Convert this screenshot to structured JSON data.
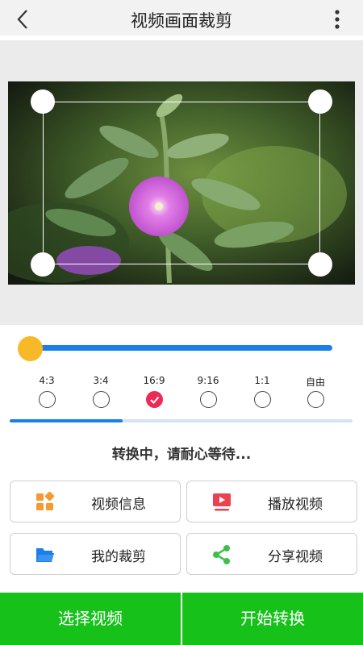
{
  "header": {
    "title": "视频画面裁剪",
    "back_icon": "back-arrow-icon",
    "more_icon": "more-vertical-icon"
  },
  "preview": {
    "image": "flower-photo",
    "handle_color": "#ffffff"
  },
  "slider": {
    "value_fraction": 0.0,
    "track_color": "#1a7fe8",
    "thumb_color": "#f7b928"
  },
  "ratios": [
    {
      "label": "4:3",
      "selected": false
    },
    {
      "label": "3:4",
      "selected": false
    },
    {
      "label": "16:9",
      "selected": true
    },
    {
      "label": "9:16",
      "selected": false
    },
    {
      "label": "1:1",
      "selected": false
    },
    {
      "label": "自由",
      "selected": false
    }
  ],
  "progress": {
    "fraction": 0.33,
    "color": "#1a7fe8"
  },
  "status_text": "转换中，请耐心等待...",
  "actions": [
    {
      "label": "视频信息",
      "icon": "grid-info-icon",
      "icon_color": "#f39a33"
    },
    {
      "label": "播放视频",
      "icon": "play-video-icon",
      "icon_color": "#ec4250"
    },
    {
      "label": "我的裁剪",
      "icon": "folder-icon",
      "icon_color": "#1a7fe8"
    },
    {
      "label": "分享视频",
      "icon": "share-icon",
      "icon_color": "#3fbf4a"
    }
  ],
  "bottom_buttons": [
    {
      "label": "选择视频",
      "color": "#16c21a"
    },
    {
      "label": "开始转换",
      "color": "#16c21a"
    }
  ]
}
